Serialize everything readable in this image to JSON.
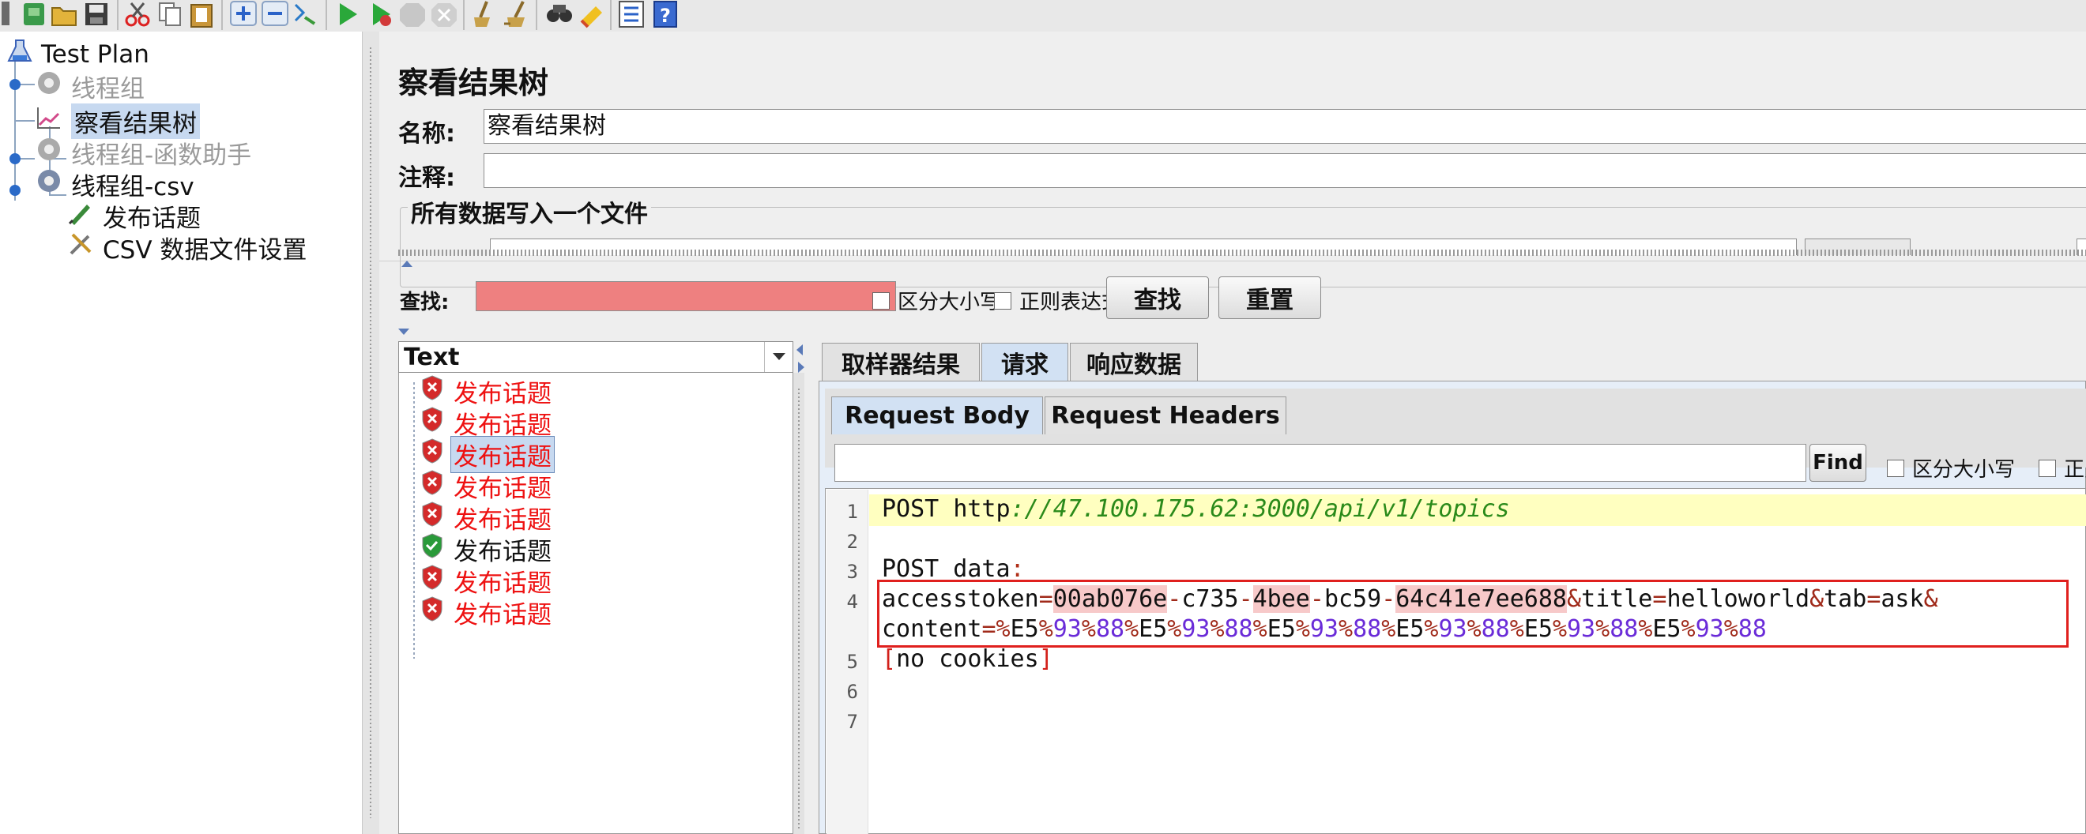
{
  "toolbar": {
    "icons": [
      "app-icon",
      "template-icon",
      "open-icon",
      "save-icon",
      "cut-icon",
      "copy-icon",
      "paste-icon",
      "add-icon",
      "remove-icon",
      "toggle-icon",
      "start-icon",
      "start-no-pause-icon",
      "stop-icon",
      "shutdown-icon",
      "clear-icon",
      "clear-all-icon",
      "search-icon",
      "reset-search-icon",
      "function-helper-icon",
      "help-icon"
    ]
  },
  "tree": {
    "items": [
      {
        "label": "Test Plan",
        "color": "#111111",
        "icon": "flask-icon"
      },
      {
        "label": "线程组",
        "color": "#9a9a9a",
        "icon": "gear-icon"
      },
      {
        "label": "察看结果树",
        "color": "#111111",
        "icon": "chart-icon",
        "selected": true
      },
      {
        "label": "线程组-函数助手",
        "color": "#9a9a9a",
        "icon": "gear-icon"
      },
      {
        "label": "线程组-csv",
        "color": "#111111",
        "icon": "gear-icon"
      },
      {
        "label": "发布话题",
        "color": "#111111",
        "icon": "pen-icon"
      },
      {
        "label": "CSV 数据文件设置",
        "color": "#111111",
        "icon": "tools-icon"
      }
    ]
  },
  "panel": {
    "title": "察看结果树",
    "name_label": "名称:",
    "name_value": "察看结果树",
    "comment_label": "注释:",
    "comment_value": "",
    "file_section_label": "所有数据写入一个文件"
  },
  "search": {
    "label": "查找:",
    "value": "",
    "case_label": "区分大小写",
    "regex_label": "正则表达式",
    "find_button": "查找",
    "reset_button": "重置",
    "field_color": "#ee8080"
  },
  "renderer": {
    "selected": "Text"
  },
  "results": [
    {
      "label": "发布话题",
      "status": "error"
    },
    {
      "label": "发布话题",
      "status": "error"
    },
    {
      "label": "发布话题",
      "status": "error",
      "selected": true
    },
    {
      "label": "发布话题",
      "status": "error"
    },
    {
      "label": "发布话题",
      "status": "error"
    },
    {
      "label": "发布话题",
      "status": "success"
    },
    {
      "label": "发布话题",
      "status": "error"
    },
    {
      "label": "发布话题",
      "status": "error"
    }
  ],
  "tabs": {
    "main": [
      "取样器结果",
      "请求",
      "响应数据"
    ],
    "main_selected": "请求",
    "sub": [
      "Request Body",
      "Request Headers"
    ],
    "sub_selected": "Request Body"
  },
  "find": {
    "value": "",
    "button": "Find",
    "case_label": "区分大小写",
    "regex_label": "正则"
  },
  "request": {
    "line_numbers": [
      "1",
      "2",
      "3",
      "4",
      "",
      "5",
      "6",
      "7"
    ],
    "line1_method": "POST",
    "line1_url_prefix": "http",
    "line1_url_rest": "://47.100.175.62:3000/api/v1/topics",
    "line3": "POST data",
    "line3_colon": ":",
    "line4": "accesstoken=00ab076e-c735-4bee-bc59-64c41e7ee688&title=helloworld&tab=ask&",
    "line4b": "content=%E5%93%88%E5%93%88%E5%93%88%E5%93%88%E5%93%88%E5%93%88",
    "line6_open": "[",
    "line6_text": "no cookies",
    "line6_close": "]"
  },
  "colors": {
    "error_text": "#ee1111",
    "highlight_line": "#ffffc0",
    "selection_blue": "#c7d9f0",
    "annotation_box": "#e0201e",
    "url_green": "#2a8a1a",
    "hex_purple": "#6a2bd8",
    "token_pink": "#f7c9c9"
  }
}
